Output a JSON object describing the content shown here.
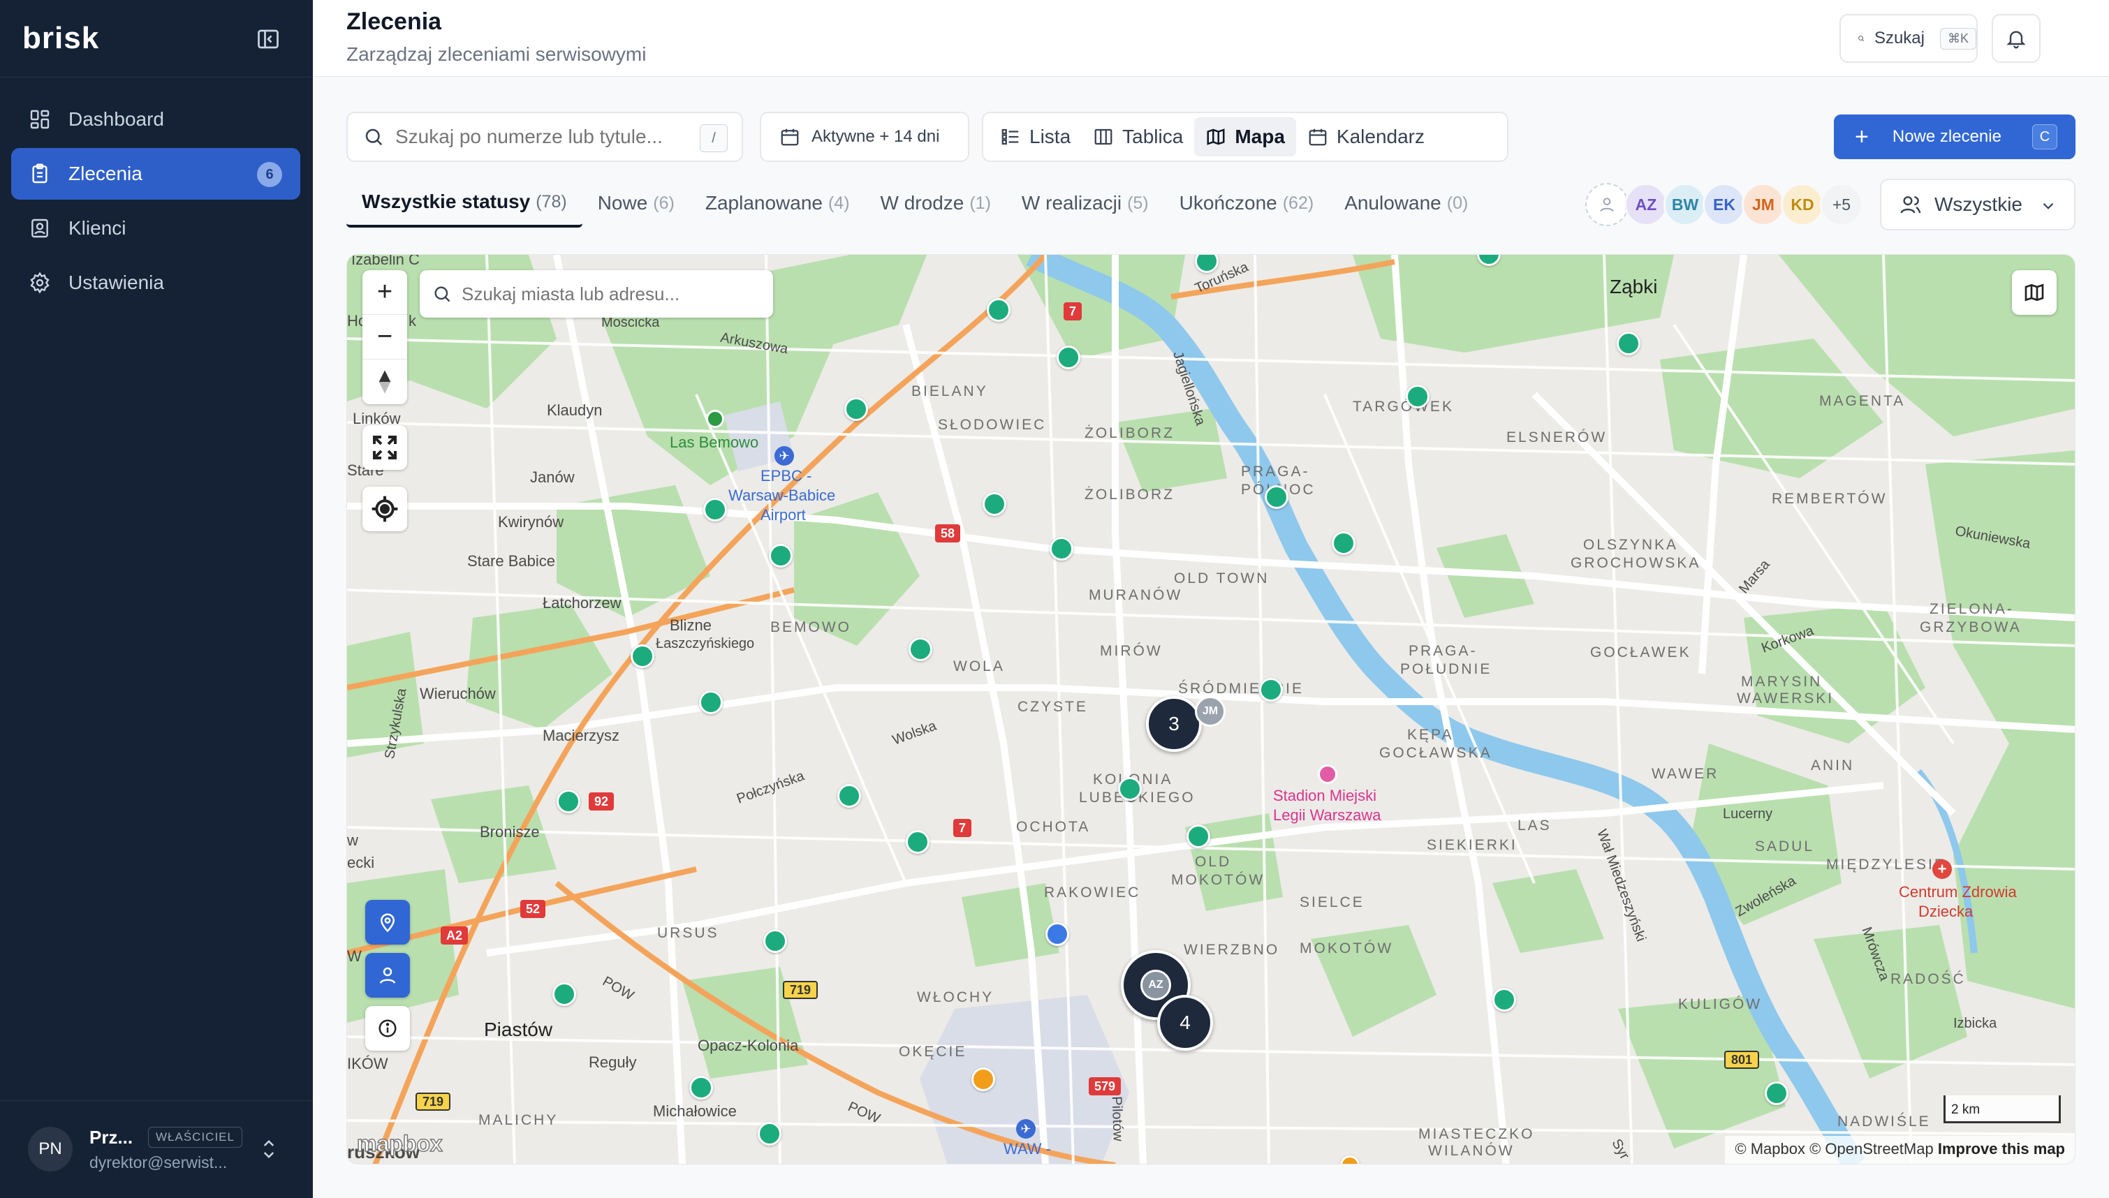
{
  "app": {
    "brand": "brisk"
  },
  "sidebar": {
    "items": [
      {
        "label": "Dashboard",
        "icon": "dashboard-icon"
      },
      {
        "label": "Zlecenia",
        "icon": "clipboard-icon",
        "badge": "6",
        "active": true
      },
      {
        "label": "Klienci",
        "icon": "contact-icon"
      },
      {
        "label": "Ustawienia",
        "icon": "gear-icon"
      }
    ],
    "user": {
      "initials": "PN",
      "name": "Prz...",
      "role": "WŁAŚCICIEL",
      "email": "dyrektor@serwist..."
    }
  },
  "header": {
    "title": "Zlecenia",
    "subtitle": "Zarządzaj zleceniami serwisowymi",
    "search_label": "Szukaj",
    "search_kbd": "⌘K"
  },
  "toolbar": {
    "search_placeholder": "Szukaj po numerze lub tytule...",
    "search_kbd": "/",
    "date_filter": "Aktywne + 14 dni",
    "views": [
      {
        "label": "Lista",
        "icon": "list-icon"
      },
      {
        "label": "Tablica",
        "icon": "columns-icon"
      },
      {
        "label": "Mapa",
        "icon": "map-icon",
        "active": true
      },
      {
        "label": "Kalendarz",
        "icon": "calendar-icon"
      }
    ],
    "new_label": "Nowe zlecenie",
    "new_kbd": "C"
  },
  "status_tabs": [
    {
      "label": "Wszystkie statusy",
      "count": "(78)",
      "active": true
    },
    {
      "label": "Nowe",
      "count": "(6)"
    },
    {
      "label": "Zaplanowane",
      "count": "(4)"
    },
    {
      "label": "W drodze",
      "count": "(1)"
    },
    {
      "label": "W realizacji",
      "count": "(5)"
    },
    {
      "label": "Ukończone",
      "count": "(62)"
    },
    {
      "label": "Anulowane",
      "count": "(0)"
    }
  ],
  "assignees": [
    {
      "initials": "AZ",
      "bg": "#e7e1f7",
      "fg": "#6d4fc2"
    },
    {
      "initials": "BW",
      "bg": "#dbeef5",
      "fg": "#2f86a6"
    },
    {
      "initials": "EK",
      "bg": "#dde6f8",
      "fg": "#3763c4"
    },
    {
      "initials": "JM",
      "bg": "#fbe4d4",
      "fg": "#d1651d"
    },
    {
      "initials": "KD",
      "bg": "#fbeed0",
      "fg": "#c08a12"
    }
  ],
  "assignees_more": "+5",
  "assignee_filter": "Wszystkie",
  "map": {
    "search_placeholder": "Szukaj miasta lub adresu...",
    "zoom_in": "+",
    "zoom_out": "−",
    "labels": {
      "izabelin": "Izabelin C",
      "ho": "Ho",
      "k": "k",
      "moscicka": "Mościcka",
      "arkuszowa": "Arkuszowa",
      "torunska": "Toruńska",
      "zabki": "Ząbki",
      "bielany": "BIELANY",
      "slodowiec": "SŁODOWIEC",
      "zoliborz1": "ŻOLIBORZ",
      "zoliborz2": "ŻOLIBORZ",
      "targowek": "TARGÓWEK",
      "magenta": "MAGENTA",
      "klaudyn": "Klaudyn",
      "las_bemowo": "Las Bemowo",
      "linkow": "Linków",
      "epbc": "EPBC -",
      "warsaw_babice": "Warsaw-Babice",
      "airport": "Airport",
      "stare": "Stare",
      "janow": "Janów",
      "praga_polnoc": "PRAGA-PÓŁNOC",
      "elsnerow": "ELSNERÓW",
      "jagiellonska": "Jagiellońska",
      "kwirynow": "Kwirynów",
      "stare_babice": "Stare Babice",
      "rembertow": "REMBERTÓW",
      "okuniewska": "Okuniewska",
      "olszynka": "OLSZYNKA",
      "grochowska": "GROCHOWSKA",
      "muranow": "MURANÓW",
      "old_town": "OLD TOWN",
      "lotrzew": "Łatchorzew",
      "blizne": "Blizne",
      "jaszczynskiego": "Łaszczyńskiego",
      "bemowo": "BEMOWO",
      "mirow": "MIRÓW",
      "wola": "WOLA",
      "srodmiescie": "ŚRÓDMIEŚCIE",
      "praga_poludnie": "PRAGA-",
      "poludnie": "POŁUDNIE",
      "marsa": "Marsa",
      "goclawek": "GOCŁAWEK",
      "korkowa": "Korkowa",
      "zielona": "ZIELONA-",
      "grzybowa": "GRZYBOWA",
      "wieruchow": "Wieruchów",
      "czyste": "CZYSTE",
      "marysin": "MARYSIN",
      "wawerski": "WAWERSKI",
      "macierzysz": "Macierzysz",
      "wolska": "Wolska",
      "kepa": "KĘPA",
      "goclawska": "GOCŁAWSKA",
      "strzykulska": "Strzykulska",
      "kolonia": "KOLONIA",
      "lubeckiego": "LUBECKIEGO",
      "stadion": "Stadion Miejski",
      "legii": "Legii Warszawa",
      "waver": "WAWER",
      "anin": "ANIN",
      "lucerny": "Lucerny",
      "bronisze": "Bronisze",
      "polczynska": "Połczyńska",
      "ochota": "OCHOTA",
      "las": "LAS",
      "siekierki": "SIEKIERKI",
      "sadul": "SADUL",
      "w_left": "w",
      "ecki": "ecki",
      "old_mokotow": "OLD",
      "mokotow_old": "MOKOTÓW",
      "miedzylesie": "MIĘDZYLESIE",
      "rakowiec": "RAKOWIEC",
      "sielce": "SIELCE",
      "centrum": "Centrum Zdrowia",
      "dziecka": "Dziecka",
      "wal": "Wał Miedzeszyński",
      "zwolenska": "Zwoleńska",
      "ursus": "URSUS",
      "w": "W",
      "wierzbno": "WIERZBNO",
      "mokotow": "MOKOTÓW",
      "radosc": "RADOŚĆ",
      "mrowcza": "Mrówcza",
      "pow1": "POW",
      "wlochy": "WŁOCHY",
      "kulikow": "KULIGÓW",
      "izbicka": "Izbicka",
      "piastow": "Piastów",
      "opacz": "Opacz-Kolonia",
      "okecie": "OKĘCIE",
      "ikow": "IKÓW",
      "reguly": "Reguły",
      "michalowice": "Michałowice",
      "pow2": "POW",
      "malichy": "MALICHY",
      "ruszkow": "ruszków",
      "waw": "WAW -",
      "pilotow": "Pilotów",
      "miasteczko": "MIASTECZKO",
      "wilanow": "WILANÓW",
      "nadwisle": "NADWIŚLE",
      "syr": "Syr"
    },
    "road_badges": [
      "7",
      "58",
      "92",
      "7",
      "52",
      "A2",
      "719",
      "579",
      "801",
      "719"
    ],
    "clusters": [
      {
        "count": "3",
        "avatar": "JM"
      },
      {
        "count": "4",
        "avatar": "AZ"
      }
    ],
    "scale": "2 km",
    "attribution": "© Mapbox © OpenStreetMap",
    "attribution_link": "Improve this map",
    "mapbox_logo": "mapbox"
  }
}
